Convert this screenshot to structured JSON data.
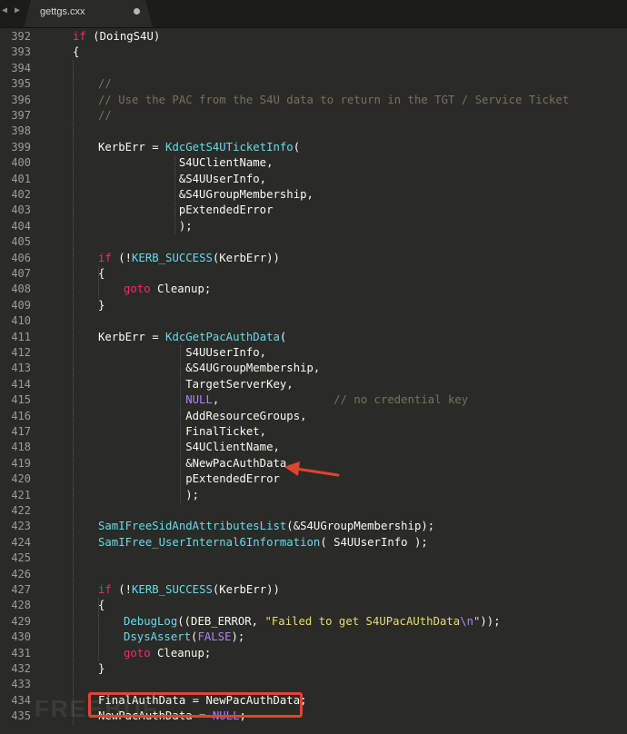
{
  "tab": {
    "title": "gettgs.cxx",
    "modified": true
  },
  "nav": {
    "arrows": "◀ ▶"
  },
  "colors": {
    "background": "#2a2b26",
    "keyword": "#f92672",
    "function": "#66d9ef",
    "comment": "#75715e",
    "string": "#e6db74",
    "constant": "#ae81ff",
    "annotation": "#e0442f"
  },
  "code_lines": [
    {
      "num": "392",
      "indent": 0,
      "tokens": [
        {
          "t": "kw",
          "v": "if"
        },
        {
          "t": "tx",
          "v": " (DoingS4U)"
        }
      ]
    },
    {
      "num": "393",
      "indent": 0,
      "tokens": [
        {
          "t": "tx",
          "v": "{"
        }
      ]
    },
    {
      "num": "394",
      "indent": 0,
      "tokens": []
    },
    {
      "num": "395",
      "indent": 1,
      "tokens": [
        {
          "t": "cm",
          "v": "//"
        }
      ]
    },
    {
      "num": "396",
      "indent": 1,
      "tokens": [
        {
          "t": "cm",
          "v": "// Use the PAC from the S4U data to return in the TGT / Service Ticket"
        }
      ]
    },
    {
      "num": "397",
      "indent": 1,
      "tokens": [
        {
          "t": "cm",
          "v": "//"
        }
      ]
    },
    {
      "num": "398",
      "indent": 0,
      "tokens": []
    },
    {
      "num": "399",
      "indent": 1,
      "tokens": [
        {
          "t": "tx",
          "v": "KerbErr = "
        },
        {
          "t": "fn",
          "v": "KdcGetS4UTicketInfo"
        },
        {
          "t": "tx",
          "v": "("
        }
      ]
    },
    {
      "num": "400",
      "indent": 1,
      "tokens": [
        {
          "t": "tx",
          "v": "            S4UClientName,"
        }
      ]
    },
    {
      "num": "401",
      "indent": 1,
      "tokens": [
        {
          "t": "tx",
          "v": "            &S4UUserInfo,"
        }
      ]
    },
    {
      "num": "402",
      "indent": 1,
      "tokens": [
        {
          "t": "tx",
          "v": "            &S4UGroupMembership,"
        }
      ]
    },
    {
      "num": "403",
      "indent": 1,
      "tokens": [
        {
          "t": "tx",
          "v": "            pExtendedError"
        }
      ]
    },
    {
      "num": "404",
      "indent": 1,
      "tokens": [
        {
          "t": "tx",
          "v": "            );"
        }
      ]
    },
    {
      "num": "405",
      "indent": 0,
      "tokens": []
    },
    {
      "num": "406",
      "indent": 1,
      "tokens": [
        {
          "t": "kw",
          "v": "if"
        },
        {
          "t": "tx",
          "v": " (!"
        },
        {
          "t": "fn",
          "v": "KERB_SUCCESS"
        },
        {
          "t": "tx",
          "v": "(KerbErr))"
        }
      ]
    },
    {
      "num": "407",
      "indent": 1,
      "tokens": [
        {
          "t": "tx",
          "v": "{"
        }
      ]
    },
    {
      "num": "408",
      "indent": 2,
      "tokens": [
        {
          "t": "kw",
          "v": "goto"
        },
        {
          "t": "tx",
          "v": " Cleanup;"
        }
      ]
    },
    {
      "num": "409",
      "indent": 1,
      "tokens": [
        {
          "t": "tx",
          "v": "}"
        }
      ]
    },
    {
      "num": "410",
      "indent": 0,
      "tokens": []
    },
    {
      "num": "411",
      "indent": 1,
      "tokens": [
        {
          "t": "tx",
          "v": "KerbErr = "
        },
        {
          "t": "fn",
          "v": "KdcGetPacAuthData"
        },
        {
          "t": "tx",
          "v": "("
        }
      ]
    },
    {
      "num": "412",
      "indent": 1,
      "tokens": [
        {
          "t": "tx",
          "v": "             S4UUserInfo,"
        }
      ]
    },
    {
      "num": "413",
      "indent": 1,
      "tokens": [
        {
          "t": "tx",
          "v": "             &S4UGroupMembership,"
        }
      ]
    },
    {
      "num": "414",
      "indent": 1,
      "tokens": [
        {
          "t": "tx",
          "v": "             TargetServerKey,"
        }
      ]
    },
    {
      "num": "415",
      "indent": 1,
      "tokens": [
        {
          "t": "tx",
          "v": "             "
        },
        {
          "t": "cn",
          "v": "NULL"
        },
        {
          "t": "tx",
          "v": ",                 "
        },
        {
          "t": "cm",
          "v": "// no credential key"
        }
      ]
    },
    {
      "num": "416",
      "indent": 1,
      "tokens": [
        {
          "t": "tx",
          "v": "             AddResourceGroups,"
        }
      ]
    },
    {
      "num": "417",
      "indent": 1,
      "tokens": [
        {
          "t": "tx",
          "v": "             FinalTicket,"
        }
      ]
    },
    {
      "num": "418",
      "indent": 1,
      "tokens": [
        {
          "t": "tx",
          "v": "             S4UClientName,"
        }
      ]
    },
    {
      "num": "419",
      "indent": 1,
      "tokens": [
        {
          "t": "tx",
          "v": "             &NewPacAuthData,"
        }
      ]
    },
    {
      "num": "420",
      "indent": 1,
      "tokens": [
        {
          "t": "tx",
          "v": "             pExtendedError"
        }
      ]
    },
    {
      "num": "421",
      "indent": 1,
      "tokens": [
        {
          "t": "tx",
          "v": "             );"
        }
      ]
    },
    {
      "num": "422",
      "indent": 0,
      "tokens": []
    },
    {
      "num": "423",
      "indent": 1,
      "tokens": [
        {
          "t": "fn",
          "v": "SamIFreeSidAndAttributesList"
        },
        {
          "t": "tx",
          "v": "(&S4UGroupMembership);"
        }
      ]
    },
    {
      "num": "424",
      "indent": 1,
      "tokens": [
        {
          "t": "fn",
          "v": "SamIFree_UserInternal6Information"
        },
        {
          "t": "tx",
          "v": "( S4UUserInfo );"
        }
      ]
    },
    {
      "num": "425",
      "indent": 0,
      "tokens": []
    },
    {
      "num": "426",
      "indent": 0,
      "tokens": []
    },
    {
      "num": "427",
      "indent": 1,
      "tokens": [
        {
          "t": "kw",
          "v": "if"
        },
        {
          "t": "tx",
          "v": " (!"
        },
        {
          "t": "fn",
          "v": "KERB_SUCCESS"
        },
        {
          "t": "tx",
          "v": "(KerbErr))"
        }
      ]
    },
    {
      "num": "428",
      "indent": 1,
      "tokens": [
        {
          "t": "tx",
          "v": "{"
        }
      ]
    },
    {
      "num": "429",
      "indent": 2,
      "tokens": [
        {
          "t": "fn",
          "v": "DebugLog"
        },
        {
          "t": "tx",
          "v": "((DEB_ERROR, "
        },
        {
          "t": "st",
          "v": "\"Failed to get S4UPacAUthData"
        },
        {
          "t": "es",
          "v": "\\n"
        },
        {
          "t": "st",
          "v": "\""
        },
        {
          "t": "tx",
          "v": "));"
        }
      ]
    },
    {
      "num": "430",
      "indent": 2,
      "tokens": [
        {
          "t": "fn",
          "v": "DsysAssert"
        },
        {
          "t": "tx",
          "v": "("
        },
        {
          "t": "cn",
          "v": "FALSE"
        },
        {
          "t": "tx",
          "v": ");"
        }
      ]
    },
    {
      "num": "431",
      "indent": 2,
      "tokens": [
        {
          "t": "kw",
          "v": "goto"
        },
        {
          "t": "tx",
          "v": " Cleanup;"
        }
      ]
    },
    {
      "num": "432",
      "indent": 1,
      "tokens": [
        {
          "t": "tx",
          "v": "}"
        }
      ]
    },
    {
      "num": "433",
      "indent": 0,
      "tokens": []
    },
    {
      "num": "434",
      "indent": 1,
      "tokens": [
        {
          "t": "tx",
          "v": "FinalAuthData = NewPacAuthData;"
        }
      ]
    },
    {
      "num": "435",
      "indent": 1,
      "tokens": [
        {
          "t": "tx",
          "v": "NewPacAuthData = "
        },
        {
          "t": "cn",
          "v": "NULL"
        },
        {
          "t": "tx",
          "v": ";"
        }
      ]
    }
  ],
  "watermark": "FREEBUF"
}
